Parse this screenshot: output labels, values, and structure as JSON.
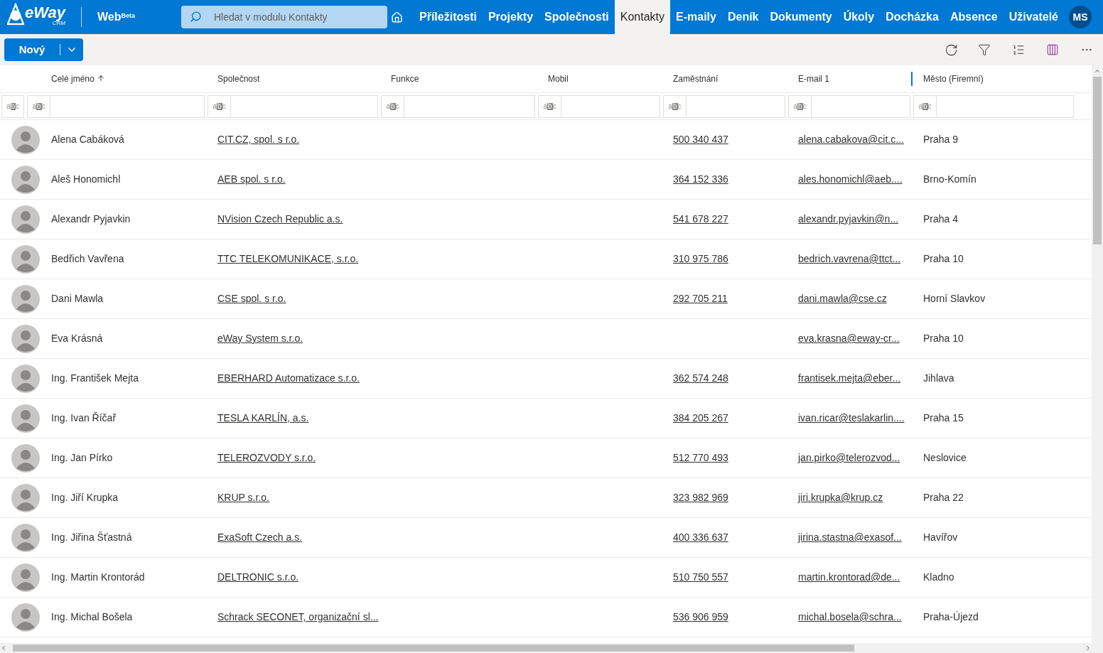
{
  "header": {
    "logo_text": "eWay",
    "logo_sub": "CRM",
    "product": "Web",
    "product_badge": "Beta",
    "search": {
      "placeholder": "Hledat v modulu Kontakty"
    },
    "nav": [
      {
        "label": "Příležitosti",
        "selected": false
      },
      {
        "label": "Projekty",
        "selected": false
      },
      {
        "label": "Společnosti",
        "selected": false
      },
      {
        "label": "Kontakty",
        "selected": true
      },
      {
        "label": "E-maily",
        "selected": false
      },
      {
        "label": "Deník",
        "selected": false
      },
      {
        "label": "Dokumenty",
        "selected": false
      },
      {
        "label": "Úkoly",
        "selected": false
      },
      {
        "label": "Docházka",
        "selected": false
      },
      {
        "label": "Absence",
        "selected": false
      },
      {
        "label": "Uživatelé",
        "selected": false
      }
    ],
    "user_initials": "MS"
  },
  "toolbar": {
    "new_button": "Nový"
  },
  "table": {
    "columns": [
      {
        "label": "Celé jméno",
        "sorted": true
      },
      {
        "label": "Společnost",
        "sorted": false
      },
      {
        "label": "Funkce",
        "sorted": false
      },
      {
        "label": "Mobil",
        "sorted": false
      },
      {
        "label": "Zaměstnání",
        "sorted": false
      },
      {
        "label": "E-mail 1",
        "sorted": false
      },
      {
        "label": "Město (Firemní)",
        "sorted": false
      }
    ],
    "filters": [
      {
        "icon": "abc"
      },
      {
        "icon": "abc"
      },
      {
        "icon": "abc"
      },
      {
        "icon": "abc"
      },
      {
        "icon": "abc"
      },
      {
        "icon": "abc"
      },
      {
        "icon": "abc"
      },
      {
        "icon": "abc"
      }
    ],
    "rows": [
      {
        "name": "Alena Cabáková",
        "company": "CIT.CZ, spol. s r.o.",
        "phone": "500 340 437",
        "email": "alena.cabakova@cit.c...",
        "city": "Praha 9"
      },
      {
        "name": "Aleš Honomichl",
        "company": "AEB spol. s r.o.",
        "phone": "364 152 336",
        "email": "ales.honomichl@aeb....",
        "city": "Brno-Komín"
      },
      {
        "name": "Alexandr Pyjavkin",
        "company": "NVision Czech Republic a.s.",
        "phone": "541 678 227",
        "email": "alexandr.pyjavkin@n...",
        "city": "Praha 4"
      },
      {
        "name": "Bedřich Vavřena",
        "company": "TTC TELEKOMUNIKACE, s.r.o.",
        "phone": "310 975 786",
        "email": "bedrich.vavrena@ttct...",
        "city": "Praha 10"
      },
      {
        "name": "Dani Mawla",
        "company": "CSE spol. s r.o.",
        "phone": "292 705 211",
        "email": "dani.mawla@cse.cz",
        "city": "Horní Slavkov"
      },
      {
        "name": "Eva Krásná",
        "company": "eWay System s.r.o.",
        "email": "eva.krasna@eway-cr...",
        "city": "Praha 10"
      },
      {
        "name": "Ing. František Mejta",
        "company": "EBERHARD Automatizace s.r.o.",
        "phone": "362 574 248",
        "email": "frantisek.mejta@eber...",
        "city": "Jihlava"
      },
      {
        "name": "Ing. Ivan Říčař",
        "company": "TESLA KARLÍN, a.s.",
        "phone": "384 205 267",
        "email": "ivan.ricar@teslakarlin....",
        "city": "Praha 15"
      },
      {
        "name": "Ing. Jan Pírko",
        "company": "TELEROZVODY s.r.o.",
        "phone": "512 770 493",
        "email": "jan.pirko@telerozvod...",
        "city": "Neslovice"
      },
      {
        "name": "Ing. Jiří Krupka",
        "company": "KRUP s.r.o.",
        "phone": "323 982 969",
        "email": "jiri.krupka@krup.cz",
        "city": "Praha 22"
      },
      {
        "name": "Ing. Jiřina Šťastná",
        "company": "ExaSoft Czech a.s.",
        "phone": "400 336 637",
        "email": "jirina.stastna@exasof...",
        "city": "Havířov"
      },
      {
        "name": "Ing. Martin Krontorád",
        "company": "DELTRONIC s.r.o.",
        "phone": "510 750 557",
        "email": "martin.krontorad@de...",
        "city": "Kladno"
      },
      {
        "name": "Ing. Michal Bošela",
        "company": "Schrack SECONET, organizační sl...",
        "phone": "536 906 959",
        "email": "michal.bosela@schra...",
        "city": "Praha-Újezd"
      }
    ]
  }
}
